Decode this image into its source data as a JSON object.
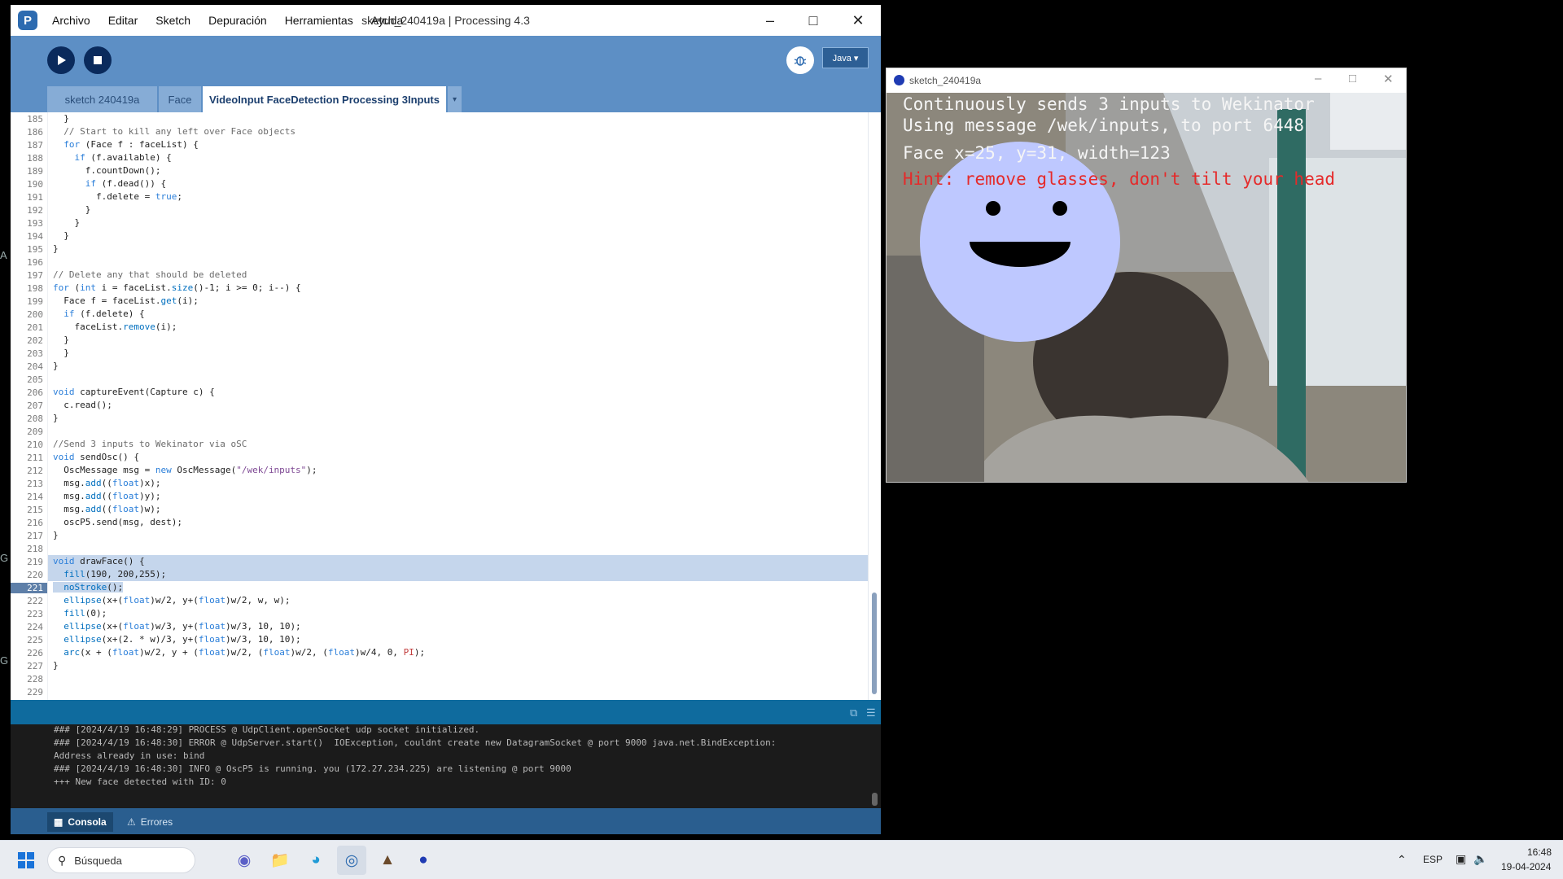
{
  "edge_letters": [
    "A",
    "G",
    "G"
  ],
  "ide": {
    "menu": [
      "Archivo",
      "Editar",
      "Sketch",
      "Depuración",
      "Herramientas",
      "Ayuda"
    ],
    "title": "sketch_240419a | Processing 4.3",
    "mode": "Java ▾",
    "tabs": [
      {
        "label": "sketch 240419a",
        "active": false
      },
      {
        "label": "Face",
        "active": false
      },
      {
        "label": "VideoInput FaceDetection Processing 3Inputs",
        "active": true
      }
    ],
    "tab_more": "▾",
    "current_line": "221",
    "line_numbers": [
      "185",
      "186",
      "187",
      "188",
      "189",
      "190",
      "191",
      "192",
      "193",
      "194",
      "195",
      "196",
      "197",
      "198",
      "199",
      "200",
      "201",
      "202",
      "203",
      "204",
      "205",
      "206",
      "207",
      "208",
      "209",
      "210",
      "211",
      "212",
      "213",
      "214",
      "215",
      "216",
      "217",
      "218",
      "219",
      "220",
      "221",
      "222",
      "223",
      "224",
      "225",
      "226",
      "227",
      "228",
      "229"
    ],
    "console": [
      "### [2024/4/19 16:48:29] PROCESS @ UdpClient.openSocket udp socket initialized.",
      "### [2024/4/19 16:48:30] ERROR @ UdpServer.start()  IOException, couldnt create new DatagramSocket @ port 9000 java.net.BindException:",
      "Address already in use: bind",
      "### [2024/4/19 16:48:30] INFO @ OscP5 is running. you (172.27.234.225) are listening @ port 9000",
      "+++ New face detected with ID: 0"
    ],
    "footer": {
      "console_label": "Consola",
      "errors_label": "Errores"
    }
  },
  "sketch_window": {
    "title": "sketch_240419a",
    "canvas_lines": [
      "Continuously sends 3 inputs to Wekinator",
      "Using message /wek/inputs, to port 6448",
      "Face x=25, y=31, width=123"
    ],
    "hint": "Hint: remove glasses, don't tilt your head",
    "face_color": "#bec8ff"
  },
  "taskbar": {
    "search_placeholder": "Búsqueda",
    "language": "ESP",
    "time": "16:48",
    "date": "19-04-2024"
  }
}
